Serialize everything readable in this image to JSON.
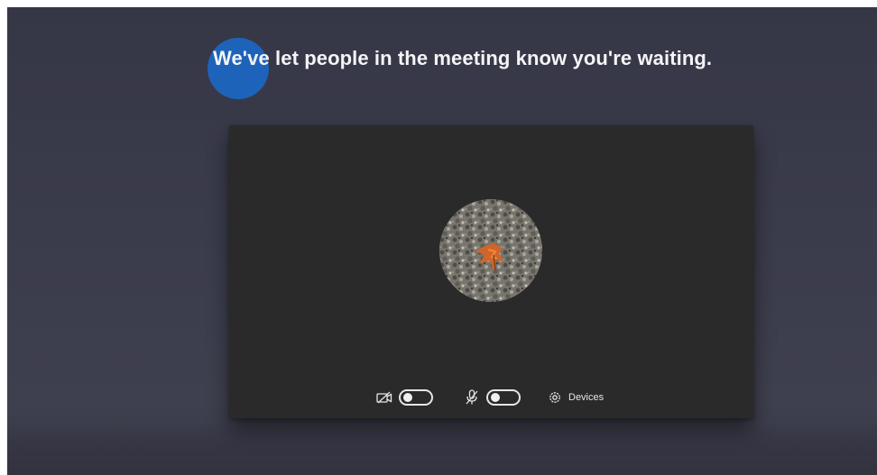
{
  "lobby": {
    "message": "We've let people in the meeting know you're waiting."
  },
  "controls": {
    "camera": {
      "icon": "camera-off-icon",
      "enabled": false
    },
    "microphone": {
      "icon": "mic-off-icon",
      "enabled": false
    },
    "devices": {
      "icon": "gear-icon",
      "label": "Devices"
    }
  },
  "colors": {
    "background": "#3b3c4c",
    "panel": "#2a2a2a",
    "highlight": "#1c67c4",
    "text": "#f4f4f6"
  }
}
